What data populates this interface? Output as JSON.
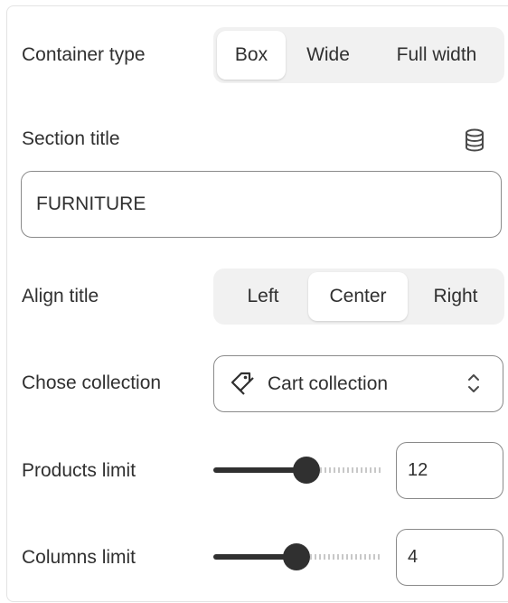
{
  "container_type": {
    "label": "Container type",
    "options": [
      "Box",
      "Wide",
      "Full width"
    ],
    "selected": "Box"
  },
  "section_title": {
    "label": "Section title",
    "icon": "database-icon",
    "value": "FURNITURE"
  },
  "align_title": {
    "label": "Align title",
    "options": [
      "Left",
      "Center",
      "Right"
    ],
    "selected": "Center"
  },
  "collection": {
    "label": "Chose collection",
    "icon": "tag-icon",
    "value": "Cart collection"
  },
  "products_limit": {
    "label": "Products limit",
    "value": "12",
    "level": 0.55
  },
  "columns_limit": {
    "label": "Columns limit",
    "value": "4",
    "level": 0.5
  }
}
